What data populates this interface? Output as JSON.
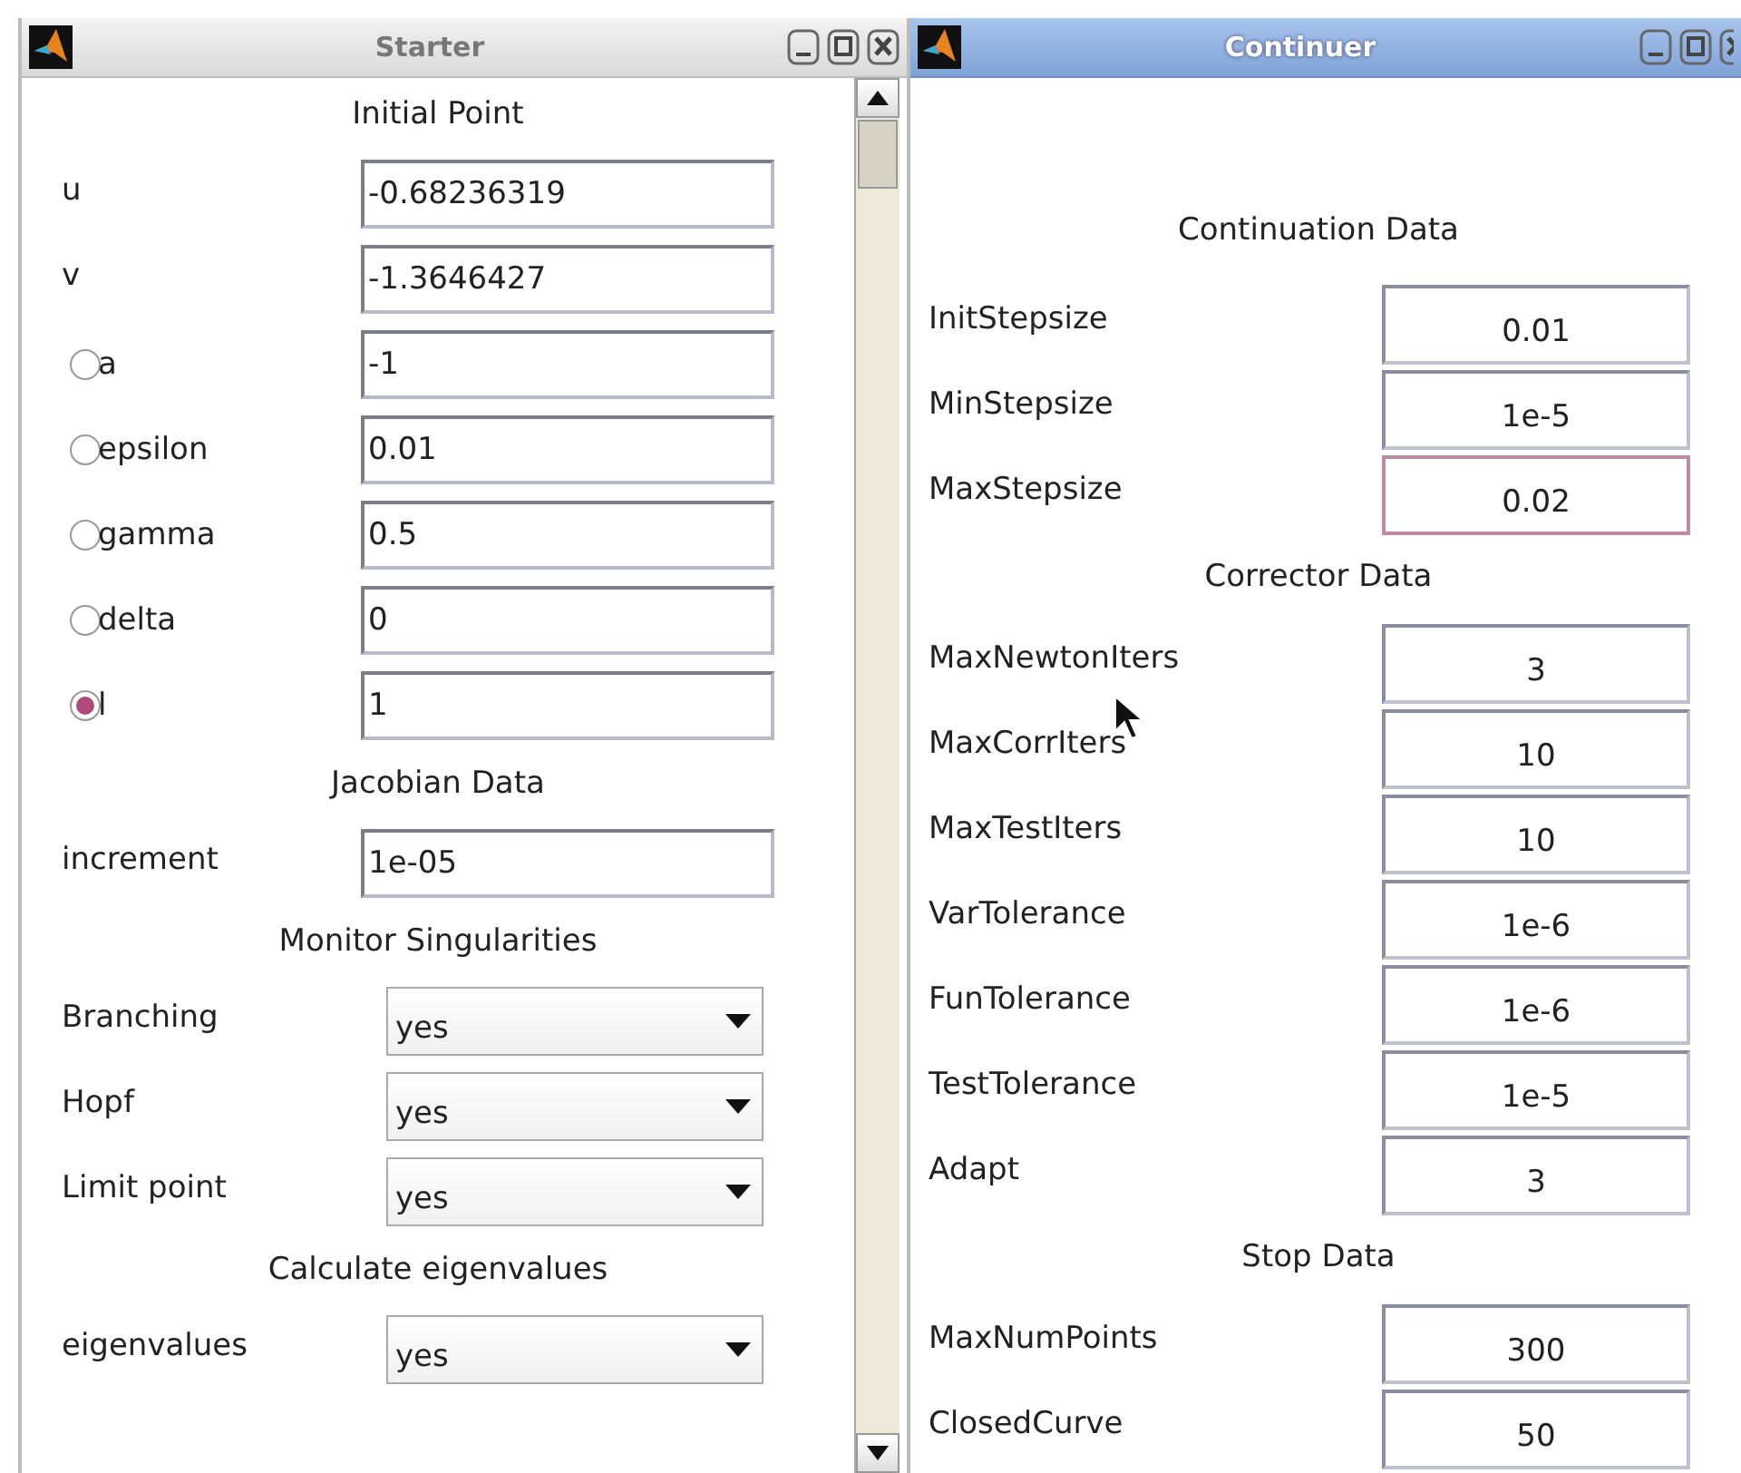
{
  "starter": {
    "title": "Starter",
    "active": false,
    "sections": [
      {
        "heading": "Initial Point",
        "rows": [
          {
            "kind": "text",
            "label": "u",
            "value": "-0.68236319"
          },
          {
            "kind": "text",
            "label": "v",
            "value": "-1.3646427"
          },
          {
            "kind": "radio",
            "label": "a",
            "value": "-1",
            "selected": false
          },
          {
            "kind": "radio",
            "label": "epsilon",
            "value": "0.01",
            "selected": false
          },
          {
            "kind": "radio",
            "label": "gamma",
            "value": "0.5",
            "selected": false
          },
          {
            "kind": "radio",
            "label": "delta",
            "value": "0",
            "selected": false
          },
          {
            "kind": "radio",
            "label": "l",
            "value": "1",
            "selected": true
          }
        ]
      },
      {
        "heading": "Jacobian Data",
        "rows": [
          {
            "kind": "text",
            "label": "increment",
            "value": "1e-05"
          }
        ]
      },
      {
        "heading": "Monitor Singularities",
        "rows": [
          {
            "kind": "select",
            "label": "Branching",
            "value": "yes"
          },
          {
            "kind": "select",
            "label": "Hopf",
            "value": "yes"
          },
          {
            "kind": "select",
            "label": "Limit point",
            "value": "yes"
          }
        ]
      },
      {
        "heading": "Calculate eigenvalues",
        "rows": [
          {
            "kind": "select",
            "label": "eigenvalues",
            "value": "yes"
          }
        ]
      }
    ]
  },
  "continuer": {
    "title": "Continuer",
    "active": true,
    "sections": [
      {
        "heading": "Continuation Data",
        "rows": [
          {
            "label": "InitStepsize",
            "value": "0.01",
            "focused": false
          },
          {
            "label": "MinStepsize",
            "value": "1e-5",
            "focused": false
          },
          {
            "label": "MaxStepsize",
            "value": "0.02",
            "focused": true
          }
        ]
      },
      {
        "heading": "Corrector Data",
        "rows": [
          {
            "label": "MaxNewtonIters",
            "value": "3",
            "focused": false
          },
          {
            "label": "MaxCorrIters",
            "value": "10",
            "focused": false
          },
          {
            "label": "MaxTestIters",
            "value": "10",
            "focused": false
          },
          {
            "label": "VarTolerance",
            "value": "1e-6",
            "focused": false
          },
          {
            "label": "FunTolerance",
            "value": "1e-6",
            "focused": false
          },
          {
            "label": "TestTolerance",
            "value": "1e-5",
            "focused": false
          },
          {
            "label": "Adapt",
            "value": "3",
            "focused": false
          }
        ]
      },
      {
        "heading": "Stop Data",
        "rows": [
          {
            "label": "MaxNumPoints",
            "value": "300",
            "focused": false
          },
          {
            "label": "ClosedCurve",
            "value": "50",
            "focused": false
          }
        ]
      }
    ]
  }
}
